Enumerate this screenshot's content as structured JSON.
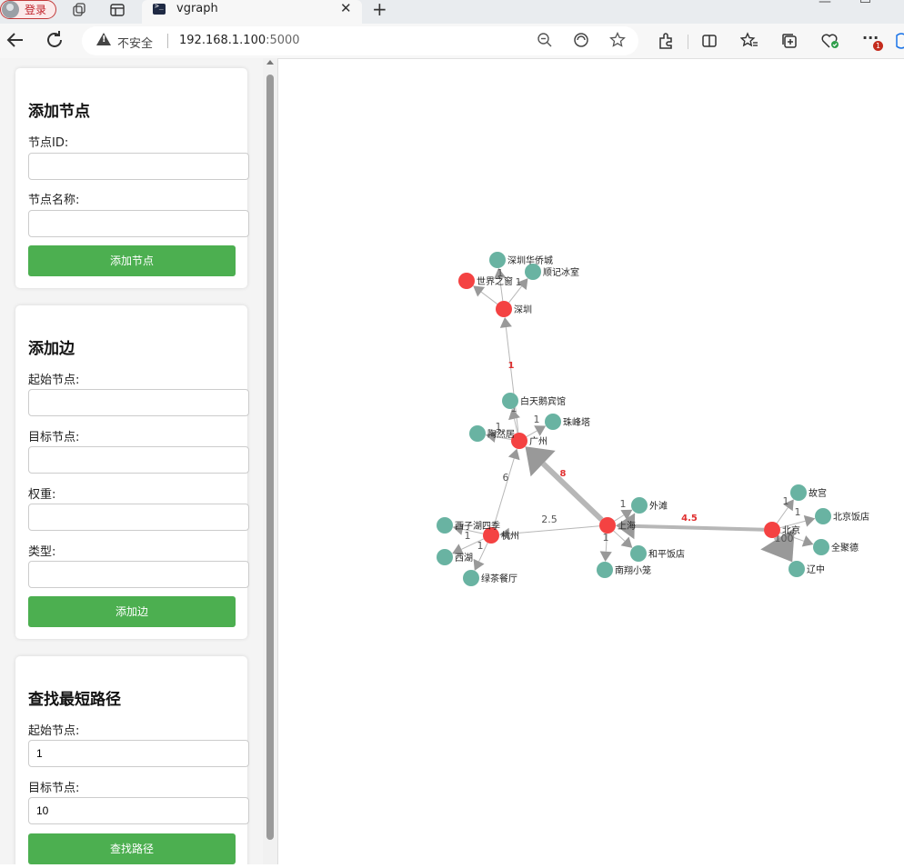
{
  "browser": {
    "profile_label": "登录",
    "tab_title": "vgraph",
    "security_label": "不安全",
    "url_host": "192.168.1.100",
    "url_port": ":5000",
    "notification_badge": "1"
  },
  "add_node": {
    "title": "添加节点",
    "id_label": "节点ID:",
    "id_value": "",
    "name_label": "节点名称:",
    "name_value": "",
    "button": "添加节点"
  },
  "add_edge": {
    "title": "添加边",
    "source_label": "起始节点:",
    "source_value": "",
    "target_label": "目标节点:",
    "target_value": "",
    "weight_label": "权重:",
    "weight_value": "",
    "type_label": "类型:",
    "type_value": "",
    "button": "添加边"
  },
  "shortest_path": {
    "title": "查找最短路径",
    "source_label": "起始节点:",
    "source_value": "1",
    "target_label": "目标节点:",
    "target_value": "10",
    "button": "查找路径"
  },
  "graph": {
    "colors": {
      "city": "#f44242",
      "poi": "#69b3a2",
      "edge": "#999999",
      "edge_label": "#555555",
      "weighted_label": "#e03030"
    },
    "nodes": [
      {
        "id": "shenzhen",
        "label": "深圳",
        "type": "city"
      },
      {
        "id": "sjzc",
        "label": "世界之窗",
        "type": "city"
      },
      {
        "id": "szhqc",
        "label": "深圳华侨城",
        "type": "poi"
      },
      {
        "id": "sjbs",
        "label": "顺记冰室",
        "type": "poi"
      },
      {
        "id": "guangzhou",
        "label": "广州",
        "type": "city"
      },
      {
        "id": "btebg",
        "label": "白天鹅宾馆",
        "type": "poi"
      },
      {
        "id": "zft",
        "label": "珠峰塔",
        "type": "poi"
      },
      {
        "id": "trj",
        "label": "陶然居",
        "type": "poi"
      },
      {
        "id": "hangzhou",
        "label": "杭州",
        "type": "city"
      },
      {
        "id": "xzhsj",
        "label": "西子湖四季",
        "type": "poi"
      },
      {
        "id": "xihu",
        "label": "西湖",
        "type": "poi"
      },
      {
        "id": "lcct",
        "label": "绿茶餐厅",
        "type": "poi"
      },
      {
        "id": "shanghai",
        "label": "上海",
        "type": "city"
      },
      {
        "id": "waitan",
        "label": "外滩",
        "type": "poi"
      },
      {
        "id": "hpft",
        "label": "和平饭店",
        "type": "poi"
      },
      {
        "id": "nxxl",
        "label": "南翔小笼",
        "type": "poi"
      },
      {
        "id": "beijing",
        "label": "北京",
        "type": "city"
      },
      {
        "id": "gugong",
        "label": "故宫",
        "type": "poi"
      },
      {
        "id": "bjft",
        "label": "北京饭店",
        "type": "poi"
      },
      {
        "id": "qjd",
        "label": "全聚德",
        "type": "poi"
      },
      {
        "id": "liaozhong",
        "label": "辽中",
        "type": "poi"
      }
    ],
    "edges": [
      {
        "source": "shenzhen",
        "target": "sjzc",
        "label": "",
        "weight": 1,
        "highlight": false
      },
      {
        "source": "shenzhen",
        "target": "szhqc",
        "label": "1",
        "weight": 1,
        "highlight": false
      },
      {
        "source": "shenzhen",
        "target": "sjbs",
        "label": "1",
        "weight": 1,
        "highlight": false
      },
      {
        "source": "guangzhou",
        "target": "shenzhen",
        "label": "1",
        "weight": 1,
        "highlight": true
      },
      {
        "source": "guangzhou",
        "target": "btebg",
        "label": "1",
        "weight": 1,
        "highlight": false
      },
      {
        "source": "guangzhou",
        "target": "zft",
        "label": "1",
        "weight": 1,
        "highlight": false
      },
      {
        "source": "guangzhou",
        "target": "trj",
        "label": "1",
        "weight": 1,
        "highlight": false
      },
      {
        "source": "hangzhou",
        "target": "guangzhou",
        "label": "6",
        "weight": 1,
        "highlight": false
      },
      {
        "source": "hangzhou",
        "target": "xzhsj",
        "label": "1",
        "weight": 1,
        "highlight": false
      },
      {
        "source": "hangzhou",
        "target": "xihu",
        "label": "1",
        "weight": 1,
        "highlight": false
      },
      {
        "source": "hangzhou",
        "target": "lcct",
        "label": "",
        "weight": 1,
        "highlight": false
      },
      {
        "source": "shanghai",
        "target": "hangzhou",
        "label": "2.5",
        "weight": 1,
        "highlight": false
      },
      {
        "source": "shanghai",
        "target": "guangzhou",
        "label": "8",
        "weight": 6,
        "highlight": true
      },
      {
        "source": "shanghai",
        "target": "waitan",
        "label": "1",
        "weight": 1,
        "highlight": false
      },
      {
        "source": "shanghai",
        "target": "hpft",
        "label": "",
        "weight": 1,
        "highlight": false
      },
      {
        "source": "shanghai",
        "target": "nxxl",
        "label": "1",
        "weight": 1,
        "highlight": false
      },
      {
        "source": "beijing",
        "target": "shanghai",
        "label": "4.5",
        "weight": 4,
        "highlight": true
      },
      {
        "source": "beijing",
        "target": "gugong",
        "label": "1",
        "weight": 1,
        "highlight": false
      },
      {
        "source": "beijing",
        "target": "bjft",
        "label": "1",
        "weight": 1,
        "highlight": false
      },
      {
        "source": "beijing",
        "target": "qjd",
        "label": "",
        "weight": 1,
        "highlight": false
      },
      {
        "source": "beijing",
        "target": "liaozhong",
        "label": "100",
        "weight": 7,
        "highlight": false
      }
    ]
  }
}
